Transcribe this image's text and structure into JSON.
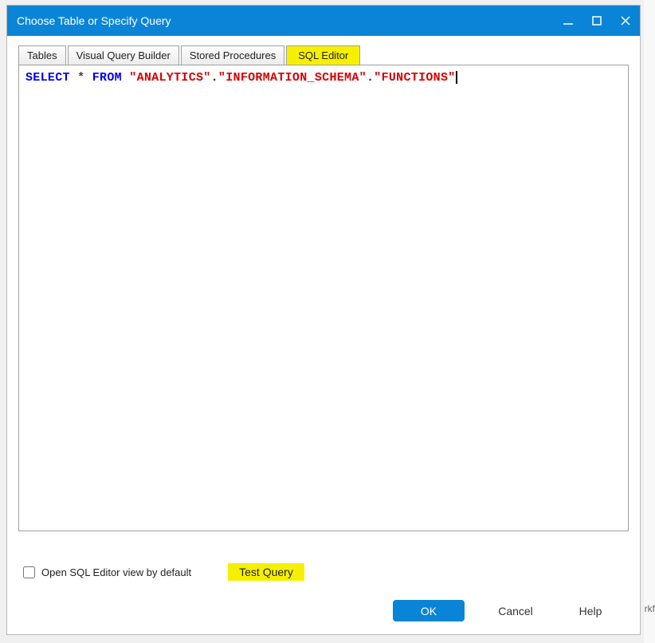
{
  "titlebar": {
    "title": "Choose Table or Specify Query"
  },
  "tabs": {
    "tables": "Tables",
    "visual_query_builder": "Visual Query Builder",
    "stored_procedures": "Stored Procedures",
    "sql_editor": "SQL Editor"
  },
  "sql": {
    "kw_select": "SELECT",
    "op_star": "*",
    "kw_from": "FROM",
    "str_schema1": "\"ANALYTICS\"",
    "dot1": ".",
    "str_schema2": "\"INFORMATION_SCHEMA\"",
    "dot2": ".",
    "str_schema3": "\"FUNCTIONS\""
  },
  "options": {
    "open_default_label": "Open SQL Editor view by default",
    "open_default_checked": false,
    "test_query_label": "Test Query"
  },
  "buttons": {
    "ok": "OK",
    "cancel": "Cancel",
    "help": "Help"
  },
  "behind": {
    "partial": "rkf"
  }
}
